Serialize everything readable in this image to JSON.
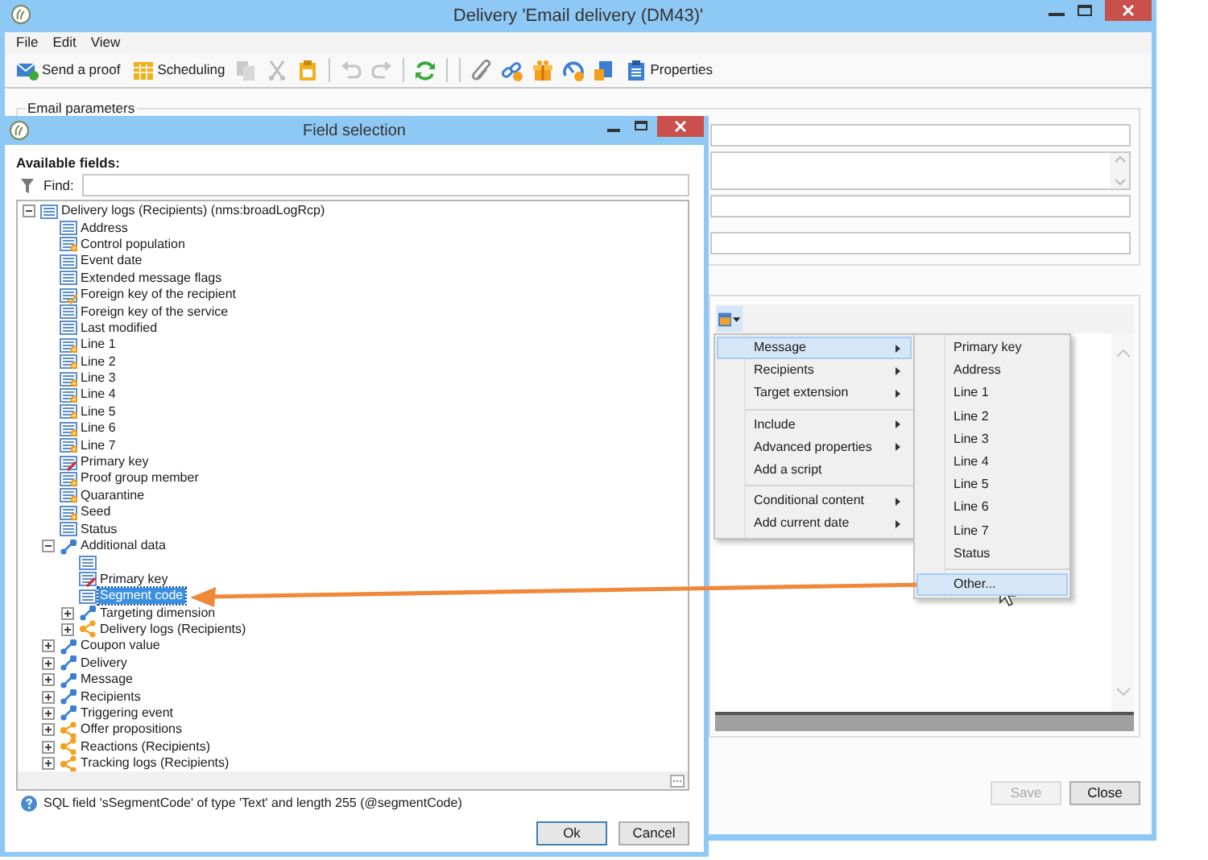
{
  "window": {
    "title": "Delivery 'Email delivery (DM43)'",
    "menu": [
      "File",
      "Edit",
      "View"
    ],
    "toolbar": [
      {
        "kind": "proof",
        "label": "Send a proof"
      },
      {
        "kind": "scheduling",
        "label": "Scheduling"
      },
      {
        "kind": "copy",
        "disabled": true
      },
      {
        "kind": "cut",
        "disabled": true
      },
      {
        "kind": "paste",
        "disabled": false
      },
      {
        "kind": "separator"
      },
      {
        "kind": "undo",
        "disabled": true
      },
      {
        "kind": "redo",
        "disabled": true
      },
      {
        "kind": "separator"
      },
      {
        "kind": "refresh",
        "disabled": false
      },
      {
        "kind": "separator"
      },
      {
        "kind": "separator"
      },
      {
        "kind": "attach",
        "disabled": false
      },
      {
        "kind": "link",
        "disabled": false
      },
      {
        "kind": "gift",
        "disabled": false
      },
      {
        "kind": "gauge",
        "disabled": false
      },
      {
        "kind": "import",
        "disabled": false
      },
      {
        "kind": "properties",
        "label": "Properties"
      }
    ],
    "group_title": "Email parameters",
    "buttons": [
      {
        "label": "Save",
        "disabled": true
      },
      {
        "label": "Close",
        "disabled": false
      }
    ]
  },
  "context_menu": {
    "items": [
      {
        "kind": "item",
        "label": "Message",
        "submenu": true,
        "selected": true
      },
      {
        "kind": "item",
        "label": "Recipients",
        "submenu": true,
        "selected": false
      },
      {
        "kind": "item",
        "label": "Target extension",
        "submenu": true,
        "selected": false
      },
      {
        "kind": "separator"
      },
      {
        "kind": "item",
        "label": "Include",
        "submenu": true,
        "selected": false
      },
      {
        "kind": "item",
        "label": "Advanced properties",
        "submenu": true,
        "selected": false
      },
      {
        "kind": "item",
        "label": "Add a script",
        "submenu": false,
        "selected": false
      },
      {
        "kind": "separator"
      },
      {
        "kind": "item",
        "label": "Conditional content",
        "submenu": true,
        "selected": false
      },
      {
        "kind": "item",
        "label": "Add current date",
        "submenu": true,
        "selected": false
      }
    ],
    "submenu": [
      {
        "kind": "item",
        "label": "Primary key",
        "selected": false
      },
      {
        "kind": "item",
        "label": "Address",
        "selected": false
      },
      {
        "kind": "item",
        "label": "Line 1",
        "selected": false
      },
      {
        "kind": "item",
        "label": "Line 2",
        "selected": false
      },
      {
        "kind": "item",
        "label": "Line 3",
        "selected": false
      },
      {
        "kind": "item",
        "label": "Line 4",
        "selected": false
      },
      {
        "kind": "item",
        "label": "Line 5",
        "selected": false
      },
      {
        "kind": "item",
        "label": "Line 6",
        "selected": false
      },
      {
        "kind": "item",
        "label": "Line 7",
        "selected": false
      },
      {
        "kind": "item",
        "label": "Status",
        "selected": false
      },
      {
        "kind": "separator"
      },
      {
        "kind": "item",
        "label": "Other...",
        "selected": true
      }
    ]
  },
  "dialog": {
    "title": "Field selection",
    "available_label": "Available fields:",
    "find_label": "Find:",
    "tree": [
      {
        "label": "Delivery logs (Recipients) (nms:broadLogRcp)",
        "kind": "field",
        "expanded": true,
        "selected": false,
        "children": [
          {
            "label": "Address",
            "kind": "field",
            "selected": false
          },
          {
            "label": "Control population",
            "kind": "computed",
            "selected": false
          },
          {
            "label": "Event date",
            "kind": "field",
            "selected": false
          },
          {
            "label": "Extended message flags",
            "kind": "field",
            "selected": false
          },
          {
            "label": "Foreign key of the recipient",
            "kind": "fk",
            "selected": false
          },
          {
            "label": "Foreign key of the service",
            "kind": "field",
            "selected": false
          },
          {
            "label": "Last modified",
            "kind": "field",
            "selected": false
          },
          {
            "label": "Line 1",
            "kind": "computed",
            "selected": false
          },
          {
            "label": "Line 2",
            "kind": "computed",
            "selected": false
          },
          {
            "label": "Line 3",
            "kind": "computed",
            "selected": false
          },
          {
            "label": "Line 4",
            "kind": "computed",
            "selected": false
          },
          {
            "label": "Line 5",
            "kind": "computed",
            "selected": false
          },
          {
            "label": "Line 6",
            "kind": "computed",
            "selected": false
          },
          {
            "label": "Line 7",
            "kind": "computed",
            "selected": false
          },
          {
            "label": "Primary key",
            "kind": "key",
            "selected": false
          },
          {
            "label": "Proof group member",
            "kind": "computed",
            "selected": false
          },
          {
            "label": "Quarantine",
            "kind": "computed",
            "selected": false
          },
          {
            "label": "Seed",
            "kind": "computed",
            "selected": false
          },
          {
            "label": "Status",
            "kind": "field",
            "selected": false
          },
          {
            "label": "Additional data",
            "kind": "link",
            "expanded": true,
            "selected": false,
            "children": [
              {
                "kind": "field",
                "selected": false
              },
              {
                "label": "Primary key",
                "kind": "key",
                "selected": false
              },
              {
                "label": "Segment code",
                "kind": "field",
                "selected": true
              },
              {
                "label": "Targeting dimension",
                "kind": "link",
                "expanded": false,
                "selected": false
              },
              {
                "label": "Delivery logs (Recipients)",
                "kind": "collection",
                "expanded": false,
                "selected": false
              }
            ]
          },
          {
            "label": "Coupon value",
            "kind": "link",
            "expanded": false,
            "selected": false
          },
          {
            "label": "Delivery",
            "kind": "link",
            "expanded": false,
            "selected": false
          },
          {
            "label": "Message",
            "kind": "link",
            "expanded": false,
            "selected": false
          },
          {
            "label": "Recipients",
            "kind": "link",
            "expanded": false,
            "selected": false
          },
          {
            "label": "Triggering event",
            "kind": "link",
            "expanded": false,
            "selected": false
          },
          {
            "label": "Offer propositions",
            "kind": "collection",
            "expanded": false,
            "selected": false
          },
          {
            "label": "Reactions (Recipients)",
            "kind": "collection",
            "expanded": false,
            "selected": false
          },
          {
            "label": "Tracking logs (Recipients)",
            "kind": "collection",
            "expanded": false,
            "selected": false
          }
        ]
      }
    ],
    "status_text": "SQL field 'sSegmentCode' of type 'Text' and length 255 (@segmentCode)",
    "buttons": [
      {
        "label": "Ok",
        "default": true
      },
      {
        "label": "Cancel",
        "default": false
      }
    ]
  }
}
